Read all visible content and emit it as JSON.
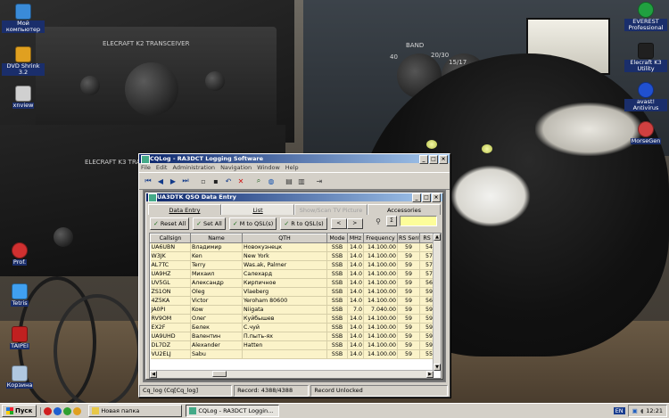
{
  "desktop": {
    "icons_left": [
      {
        "label": "Мой компьютер",
        "color": "#3a8bd8"
      },
      {
        "label": "DVD Shrink 3.2",
        "color": "#e0a020"
      },
      {
        "label": "xnview",
        "color": "#d0d0d0"
      },
      {
        "label": "Prof.",
        "color": "#d03030"
      },
      {
        "label": "Tetris",
        "color": "#40a0f0"
      },
      {
        "label": "TAIPEI",
        "color": "#c02020"
      },
      {
        "label": "Корзина",
        "color": "#b0c8e0"
      }
    ],
    "icons_right": [
      {
        "label": "EVEREST Professional",
        "color": "#20a040"
      },
      {
        "label": "Elecraft K3 Utility",
        "color": "#202020"
      },
      {
        "label": "avast! Antivirus",
        "color": "#2050d0"
      },
      {
        "label": "MorseGen",
        "color": "#d04040"
      }
    ],
    "wallpaper_labels": {
      "transceiver": "ELECRAFT K2 TRANSCEIVER",
      "transceiver2": "ELECRAFT K3 TRANSCEIVER",
      "band": "BAND",
      "b40": "40",
      "b2030": "20/30",
      "b1517": "15/17"
    }
  },
  "app": {
    "title": "CQLog - RA3DCT Logging Software",
    "menu": [
      "File",
      "Edit",
      "Administration",
      "Navigation",
      "Window",
      "Help"
    ],
    "toolbar_icons": [
      "first-icon",
      "prev-icon",
      "next-icon",
      "last-icon",
      "new-icon",
      "save-icon",
      "undo-icon",
      "delete-icon",
      "search-icon",
      "web-icon",
      "print-icon",
      "print-preview-icon",
      "exit-icon"
    ],
    "child": {
      "title": "UA3DTK QSO Data Entry",
      "tabs": [
        {
          "label": "Data Entry",
          "state": "normal"
        },
        {
          "label": "List",
          "state": "active"
        },
        {
          "label": "Show/Scan TV Picture",
          "state": "disabled"
        },
        {
          "label": "Accessories",
          "state": "normal"
        }
      ],
      "buttons": [
        "Reset All",
        "Set All",
        "M to QSL(s)",
        "R to QSL(s)"
      ],
      "nav_small": [
        "<",
        ">"
      ],
      "columns": [
        "Callsign",
        "Name",
        "QTH",
        "Mode",
        "MHz",
        "Frequency",
        "RS Sent",
        "RS"
      ],
      "rows": [
        [
          "UA6UBN",
          "Владимир",
          "Новокузнецк",
          "SSB",
          "14.0",
          "14.100.00",
          "59",
          "54"
        ],
        [
          "W3JK",
          "Ken",
          "New York",
          "SSB",
          "14.0",
          "14.100.00",
          "59",
          "57"
        ],
        [
          "AL7TC",
          "Terry",
          "Was.ak, Palmer",
          "SSB",
          "14.0",
          "14.100.00",
          "59",
          "57"
        ],
        [
          "UA9HZ",
          "Михаил",
          "Салехард",
          "SSB",
          "14.0",
          "14.100.00",
          "59",
          "57"
        ],
        [
          "UV5GL",
          "Александр",
          "Кирпичное",
          "SSB",
          "14.0",
          "14.100.00",
          "59",
          "56"
        ],
        [
          "ZS1ON",
          "Oleg",
          "Vlaeberg",
          "SSB",
          "14.0",
          "14.100.00",
          "59",
          "59"
        ],
        [
          "4Z5KA",
          "Victor",
          "Yeroham 80600",
          "SSB",
          "14.0",
          "14.100.00",
          "59",
          "56"
        ],
        [
          "JA0PI",
          "Kow",
          "Niigata",
          "SSB",
          "7.0",
          "7.040.00",
          "59",
          "59"
        ],
        [
          "RV9OM",
          "Олег",
          "Куйбышев",
          "SSB",
          "14.0",
          "14.100.00",
          "59",
          "59"
        ],
        [
          "EX2F",
          "Белек",
          "С.чуй",
          "SSB",
          "14.0",
          "14.100.00",
          "59",
          "59"
        ],
        [
          "UA9UHD",
          "Валентин",
          "П.пыть-ях",
          "SSB",
          "14.0",
          "14.100.00",
          "59",
          "59"
        ],
        [
          "DL7DZ",
          "Alexander",
          "Hatten",
          "SSB",
          "14.0",
          "14.100.00",
          "59",
          "59"
        ],
        [
          "VU2ELJ",
          "Sabu",
          "",
          "SSB",
          "14.0",
          "14.100.00",
          "59",
          "55"
        ]
      ]
    },
    "status": {
      "db": "Cq_log (Cq[Cq_log]",
      "record": "Record: 4388/4388",
      "lock": "Record Unlocked"
    }
  },
  "taskbar": {
    "start": "Пуск",
    "tasks": [
      {
        "label": "Новая папка",
        "active": false
      },
      {
        "label": "CQLog - RA3DCT Loggin...",
        "active": true
      }
    ],
    "lang": "EN",
    "clock": "12:21"
  }
}
